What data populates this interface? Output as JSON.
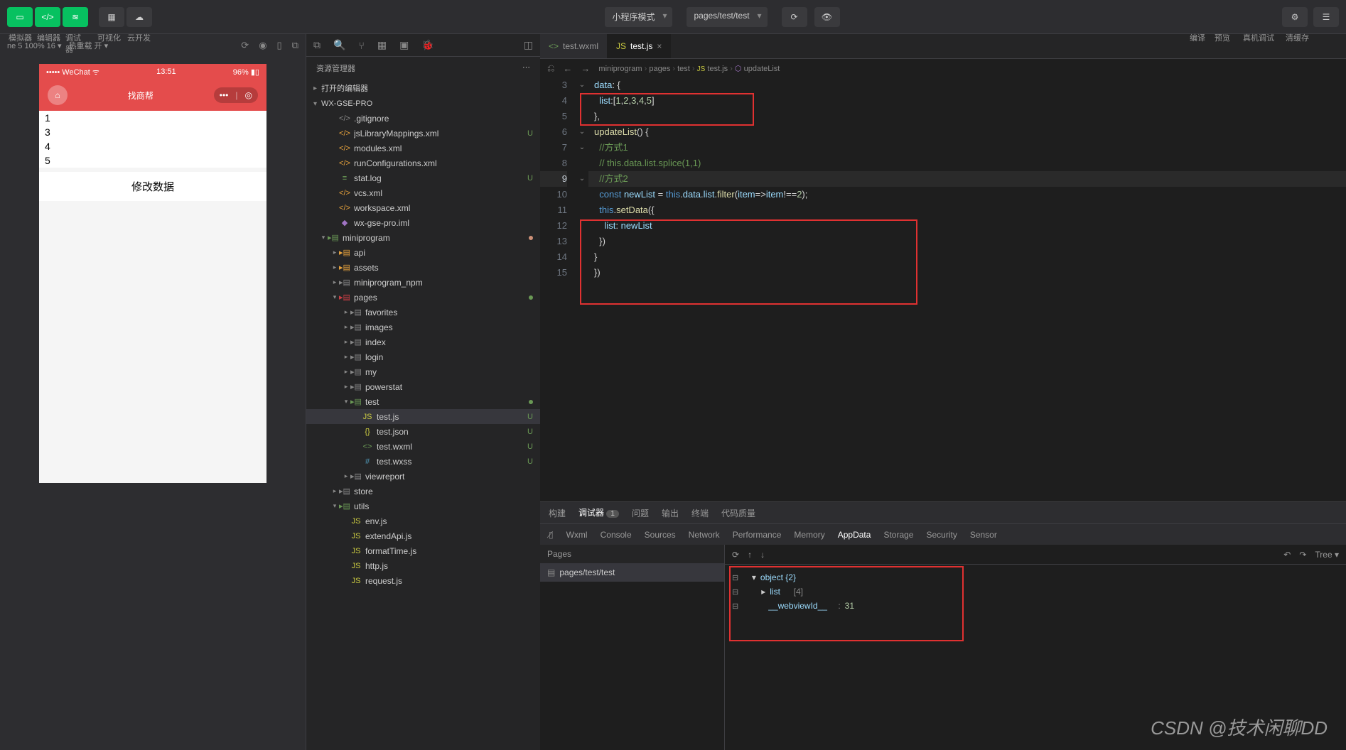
{
  "toolbar": {
    "labels": [
      "模拟器",
      "编辑器",
      "调试器",
      "可视化",
      "云开发"
    ],
    "mode_dropdown": "小程序模式",
    "path_dropdown": "pages/test/test",
    "right_labels": [
      "编译",
      "预览",
      "真机调试",
      "清缓存"
    ]
  },
  "simulator": {
    "device_info": "ne 5 100% 16 ▾",
    "reload_label": "热重载 开 ▾",
    "statusbar": {
      "carrier": "••••• WeChat",
      "time": "13:51",
      "battery": "96%"
    },
    "header": {
      "title": "找商帮"
    },
    "list": [
      "1",
      "3",
      "4",
      "5"
    ],
    "button": "修改数据"
  },
  "explorer": {
    "title": "资源管理器",
    "sections": {
      "opened": "打开的编辑器",
      "project": "WX-GSE-PRO"
    },
    "tree": [
      {
        "d": 1,
        "t": "file",
        "i": "xml",
        "c": "ic-gray",
        "l": ".gitignore",
        "b": ""
      },
      {
        "d": 1,
        "t": "file",
        "i": "xml",
        "c": "ic-orange",
        "l": "jsLibraryMappings.xml",
        "b": "U"
      },
      {
        "d": 1,
        "t": "file",
        "i": "xml",
        "c": "ic-orange",
        "l": "modules.xml",
        "b": ""
      },
      {
        "d": 1,
        "t": "file",
        "i": "xml",
        "c": "ic-orange",
        "l": "runConfigurations.xml",
        "b": ""
      },
      {
        "d": 1,
        "t": "file",
        "i": "log",
        "c": "ic-green",
        "l": "stat.log",
        "b": "U"
      },
      {
        "d": 1,
        "t": "file",
        "i": "xml",
        "c": "ic-orange",
        "l": "vcs.xml",
        "b": ""
      },
      {
        "d": 1,
        "t": "file",
        "i": "xml",
        "c": "ic-orange",
        "l": "workspace.xml",
        "b": ""
      },
      {
        "d": 1,
        "t": "file",
        "i": "iml",
        "c": "ic-purple",
        "l": "wx-gse-pro.iml",
        "b": ""
      },
      {
        "d": 0,
        "t": "folder-open",
        "i": "📁",
        "c": "ic-green",
        "l": "miniprogram",
        "dot": "orange"
      },
      {
        "d": 1,
        "t": "folder",
        "i": "📁",
        "c": "ic-orange",
        "l": "api",
        "b": ""
      },
      {
        "d": 1,
        "t": "folder",
        "i": "📁",
        "c": "ic-orange",
        "l": "assets",
        "b": ""
      },
      {
        "d": 1,
        "t": "folder",
        "i": "📁",
        "c": "ic-gray",
        "l": "miniprogram_npm",
        "b": ""
      },
      {
        "d": 1,
        "t": "folder-open",
        "i": "📁",
        "c": "ic-red",
        "l": "pages",
        "dot": "green"
      },
      {
        "d": 2,
        "t": "folder",
        "i": "📁",
        "c": "ic-gray",
        "l": "favorites",
        "b": ""
      },
      {
        "d": 2,
        "t": "folder",
        "i": "📁",
        "c": "ic-gray",
        "l": "images",
        "b": ""
      },
      {
        "d": 2,
        "t": "folder",
        "i": "📁",
        "c": "ic-gray",
        "l": "index",
        "b": ""
      },
      {
        "d": 2,
        "t": "folder",
        "i": "📁",
        "c": "ic-gray",
        "l": "login",
        "b": ""
      },
      {
        "d": 2,
        "t": "folder",
        "i": "📁",
        "c": "ic-gray",
        "l": "my",
        "b": ""
      },
      {
        "d": 2,
        "t": "folder",
        "i": "📁",
        "c": "ic-gray",
        "l": "powerstat",
        "b": ""
      },
      {
        "d": 2,
        "t": "folder-open",
        "i": "📁",
        "c": "ic-green",
        "l": "test",
        "dot": "green"
      },
      {
        "d": 3,
        "t": "file",
        "i": "JS",
        "c": "ic-yellow",
        "l": "test.js",
        "b": "U",
        "active": true
      },
      {
        "d": 3,
        "t": "file",
        "i": "{}",
        "c": "ic-yellow",
        "l": "test.json",
        "b": "U"
      },
      {
        "d": 3,
        "t": "file",
        "i": "<>",
        "c": "ic-green",
        "l": "test.wxml",
        "b": "U"
      },
      {
        "d": 3,
        "t": "file",
        "i": "#",
        "c": "ic-blue",
        "l": "test.wxss",
        "b": "U"
      },
      {
        "d": 2,
        "t": "folder",
        "i": "📁",
        "c": "ic-gray",
        "l": "viewreport",
        "b": ""
      },
      {
        "d": 1,
        "t": "folder",
        "i": "📁",
        "c": "ic-gray",
        "l": "store",
        "b": ""
      },
      {
        "d": 1,
        "t": "folder-open",
        "i": "📁",
        "c": "ic-green",
        "l": "utils",
        "b": ""
      },
      {
        "d": 2,
        "t": "file",
        "i": "JS",
        "c": "ic-yellow",
        "l": "env.js",
        "b": ""
      },
      {
        "d": 2,
        "t": "file",
        "i": "JS",
        "c": "ic-yellow",
        "l": "extendApi.js",
        "b": ""
      },
      {
        "d": 2,
        "t": "file",
        "i": "JS",
        "c": "ic-yellow",
        "l": "formatTime.js",
        "b": ""
      },
      {
        "d": 2,
        "t": "file",
        "i": "JS",
        "c": "ic-yellow",
        "l": "http.js",
        "b": ""
      },
      {
        "d": 2,
        "t": "file",
        "i": "JS",
        "c": "ic-yellow",
        "l": "request.js",
        "b": ""
      }
    ]
  },
  "editor": {
    "tabs": [
      {
        "icon": "<>",
        "icon_class": "ic-green",
        "label": "test.wxml",
        "active": false
      },
      {
        "icon": "JS",
        "icon_class": "ic-yellow",
        "label": "test.js",
        "active": true
      }
    ],
    "breadcrumb": [
      "miniprogram",
      "pages",
      "test",
      "test.js",
      "updateList"
    ],
    "line_start": 3,
    "current_line": 9
  },
  "debugger": {
    "tabs1": [
      "构建",
      "调试器",
      "问题",
      "输出",
      "终端",
      "代码质量"
    ],
    "tabs1_badge": "1",
    "tabs1_active": 1,
    "tabs2": [
      "Wxml",
      "Console",
      "Sources",
      "Network",
      "Performance",
      "Memory",
      "AppData",
      "Storage",
      "Security",
      "Sensor"
    ],
    "tabs2_active": 6,
    "pages_header": "Pages",
    "page": "pages/test/test",
    "tree_dropdown": "Tree ▾",
    "data": {
      "root": "object  {2}",
      "list_key": "list",
      "list_count": "[4]",
      "webview_key": "__webviewId__",
      "webview_sep": ":",
      "webview_val": "31"
    }
  },
  "watermark": "CSDN @技术闲聊DD"
}
